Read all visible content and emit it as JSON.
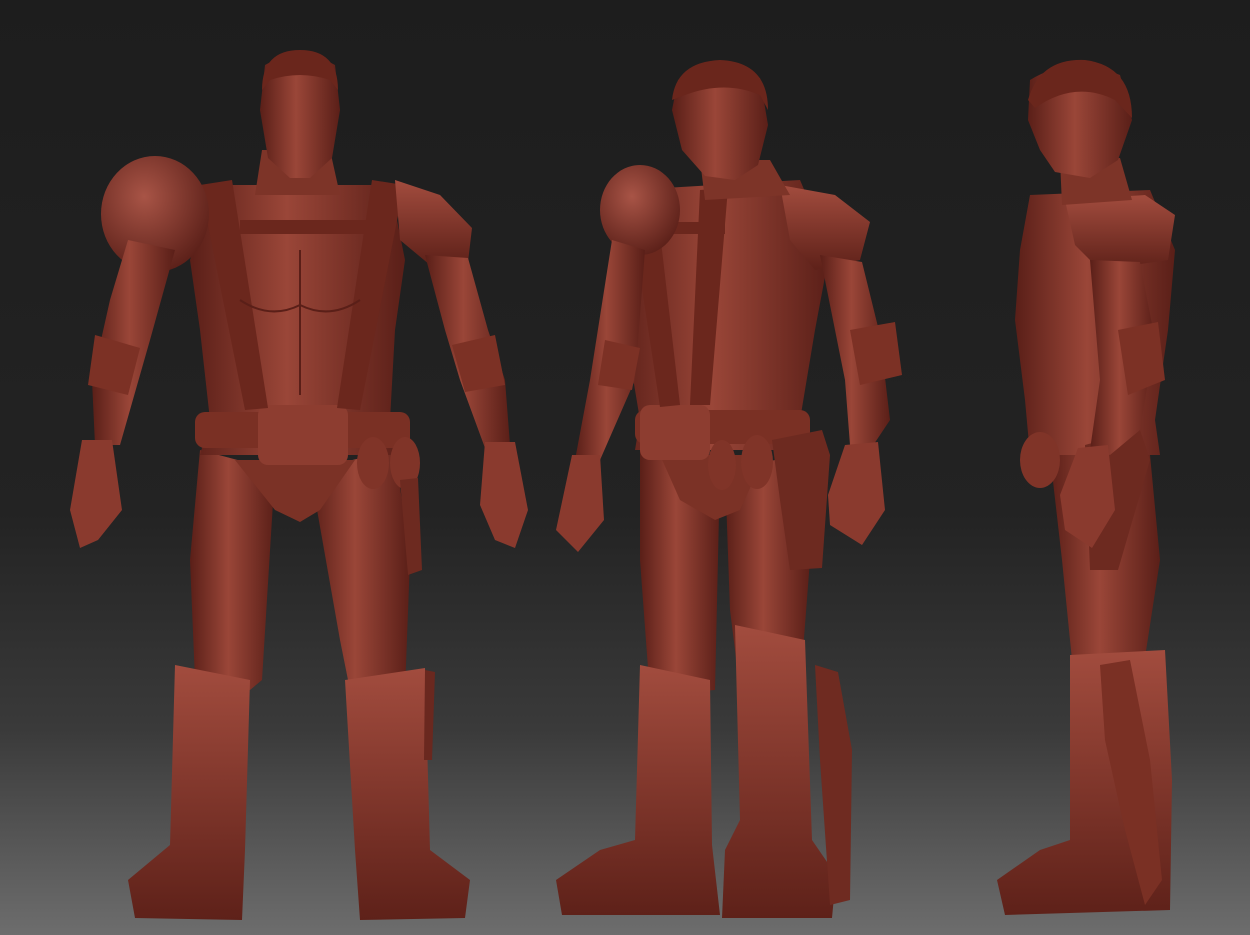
{
  "scene": {
    "kind": "3d-sculpt-turnaround",
    "material_color": "#8a3a30",
    "material_shadow": "#4a1914",
    "material_highlight": "#b5584a",
    "background_top": "#1d1d1d",
    "background_bottom": "#6d6d6d",
    "views": [
      {
        "name": "front-view",
        "label": ""
      },
      {
        "name": "three-quarter-view",
        "label": ""
      },
      {
        "name": "side-view",
        "label": ""
      }
    ]
  }
}
